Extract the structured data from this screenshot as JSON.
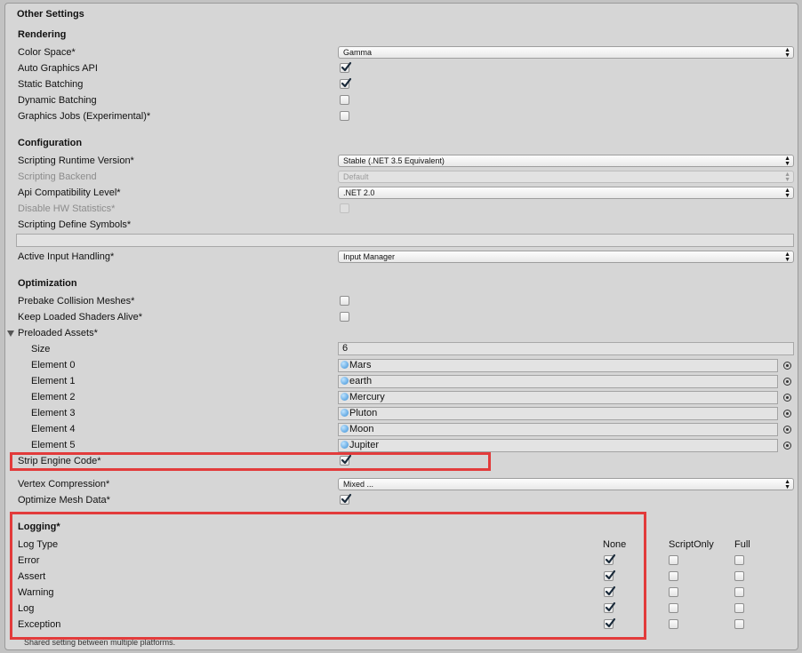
{
  "header": {
    "title": "Other Settings"
  },
  "rendering": {
    "heading": "Rendering",
    "color_space": {
      "label": "Color Space*",
      "value": "Gamma"
    },
    "auto_graphics_api": {
      "label": "Auto Graphics API",
      "checked": true
    },
    "static_batching": {
      "label": "Static Batching",
      "checked": true
    },
    "dynamic_batching": {
      "label": "Dynamic Batching",
      "checked": false
    },
    "graphics_jobs": {
      "label": "Graphics Jobs (Experimental)*",
      "checked": false
    }
  },
  "configuration": {
    "heading": "Configuration",
    "scripting_runtime": {
      "label": "Scripting Runtime Version*",
      "value": "Stable (.NET 3.5 Equivalent)"
    },
    "scripting_backend": {
      "label": "Scripting Backend",
      "value": "Default"
    },
    "api_compat": {
      "label": "Api Compatibility Level*",
      "value": ".NET 2.0"
    },
    "disable_hw_stats": {
      "label": "Disable HW Statistics*",
      "checked": false
    },
    "define_symbols": {
      "label": "Scripting Define Symbols*",
      "value": ""
    },
    "input_handling": {
      "label": "Active Input Handling*",
      "value": "Input Manager"
    }
  },
  "optimization": {
    "heading": "Optimization",
    "prebake": {
      "label": "Prebake Collision Meshes*",
      "checked": false
    },
    "keep_shaders": {
      "label": "Keep Loaded Shaders Alive*",
      "checked": false
    },
    "preloaded": {
      "label": "Preloaded Assets*",
      "size_label": "Size",
      "size_value": "6",
      "elements": [
        {
          "label": "Element 0",
          "value": "Mars"
        },
        {
          "label": "Element 1",
          "value": "earth"
        },
        {
          "label": "Element 2",
          "value": "Mercury"
        },
        {
          "label": "Element 3",
          "value": "Pluton"
        },
        {
          "label": "Element 4",
          "value": "Moon"
        },
        {
          "label": "Element 5",
          "value": "Jupiter"
        }
      ]
    },
    "strip_engine": {
      "label": "Strip Engine Code*",
      "checked": true
    },
    "vertex_compression": {
      "label": "Vertex Compression*",
      "value": "Mixed ..."
    },
    "optimize_mesh": {
      "label": "Optimize Mesh Data*",
      "checked": true
    }
  },
  "logging": {
    "heading": "Logging*",
    "type_header": "Log Type",
    "columns": [
      "None",
      "ScriptOnly",
      "Full"
    ],
    "rows": [
      {
        "label": "Error",
        "none": true,
        "script_only": false,
        "full": false
      },
      {
        "label": "Assert",
        "none": true,
        "script_only": false,
        "full": false
      },
      {
        "label": "Warning",
        "none": true,
        "script_only": false,
        "full": false
      },
      {
        "label": "Log",
        "none": true,
        "script_only": false,
        "full": false
      },
      {
        "label": "Exception",
        "none": true,
        "script_only": false,
        "full": false
      }
    ],
    "footnote": "Shared setting between multiple platforms."
  },
  "colors": {
    "highlight": "#e23b3b",
    "panel": "#d6d6d6"
  }
}
